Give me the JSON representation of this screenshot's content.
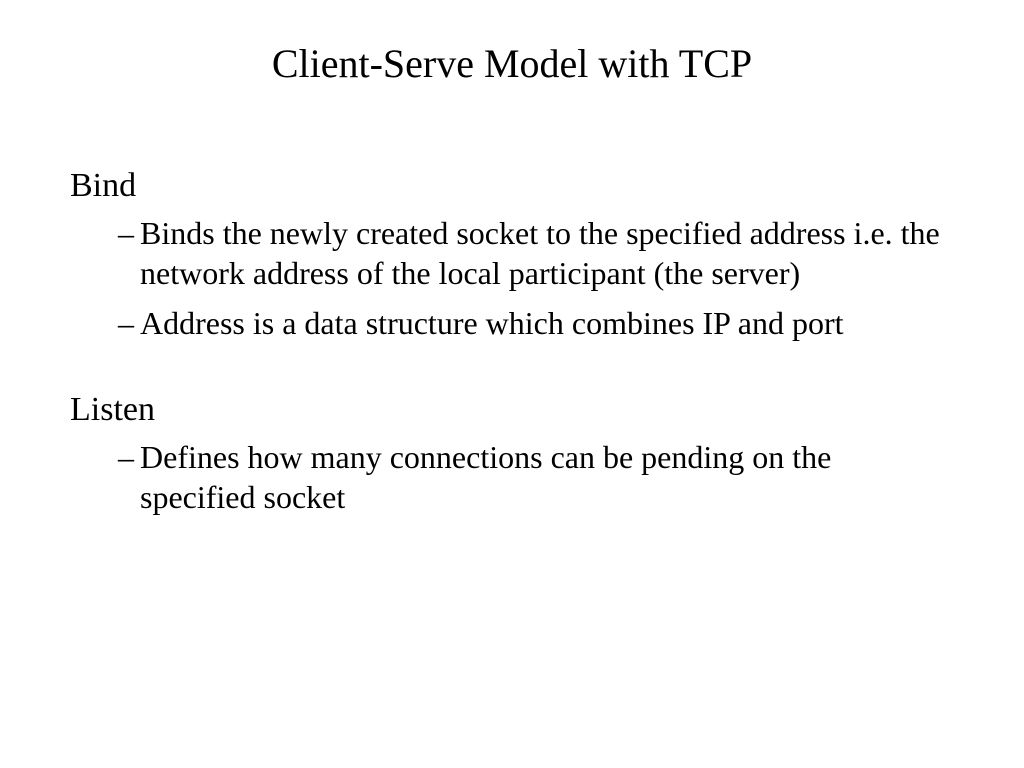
{
  "title": "Client-Serve Model with TCP",
  "sections": [
    {
      "heading": "Bind",
      "bullets": [
        "Binds the newly created socket to the specified address i.e. the network address of the local participant (the server)",
        "Address is a data structure which combines IP and port"
      ]
    },
    {
      "heading": "Listen",
      "bullets": [
        "Defines how many connections can be pending on the specified socket"
      ]
    }
  ]
}
